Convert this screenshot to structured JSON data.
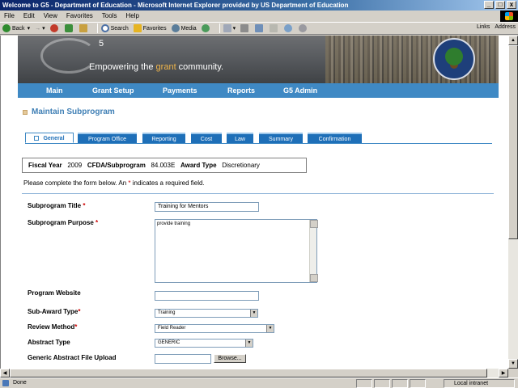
{
  "window": {
    "title": "Welcome to G5 - Department of Education - Microsoft Internet Explorer provided by US Department of Education",
    "minimize": "_",
    "maximize": "□",
    "close": "x"
  },
  "menubar": [
    "File",
    "Edit",
    "View",
    "Favorites",
    "Tools",
    "Help"
  ],
  "toolbar": {
    "back": "Back",
    "search": "Search",
    "favorites": "Favorites",
    "media": "Media",
    "links": "Links",
    "address": "Address"
  },
  "banner": {
    "logo_letter": "G",
    "logo_number": "5",
    "tagline_before": "Empowering the ",
    "tagline_highlight": "grant",
    "tagline_after": " community."
  },
  "nav": [
    "Main",
    "Grant Setup",
    "Payments",
    "Reports",
    "G5 Admin"
  ],
  "page_title": "Maintain Subprogram",
  "tabs": [
    "General",
    "Program Office",
    "Reporting",
    "Cost",
    "Law",
    "Summary",
    "Confirmation"
  ],
  "info": {
    "fiscal_year_label": "Fiscal Year",
    "fiscal_year": "2009",
    "cfda_label": "CFDA/Subprogram",
    "cfda": "84.003E",
    "award_type_label": "Award Type",
    "award_type": "Discretionary"
  },
  "instruction": {
    "before": "Please complete the form below. An ",
    "star": "*",
    "after": " indicates a required field."
  },
  "form": {
    "title_label": "Subprogram Title",
    "title_value": "Training for Mentors",
    "purpose_label": "Subprogram Purpose",
    "purpose_value": "provide training",
    "website_label": "Program Website",
    "website_value": "",
    "subaward_label": "Sub-Award Type",
    "subaward_value": "Training",
    "review_label": "Review Method",
    "review_value": "Field Reader",
    "abstract_label": "Abstract Type",
    "abstract_value": "GENERIC",
    "upload_label": "Generic Abstract File Upload",
    "browse": "Browse...",
    "required_star": "*"
  },
  "status": {
    "done": "Done",
    "zone": "Local intranet"
  },
  "colors": {
    "nav_bar": "#3f89c4",
    "tab": "#1e6fb8",
    "page_title": "#3f7fb5",
    "required": "#cc0000",
    "brand_highlight": "#f0b54a"
  }
}
